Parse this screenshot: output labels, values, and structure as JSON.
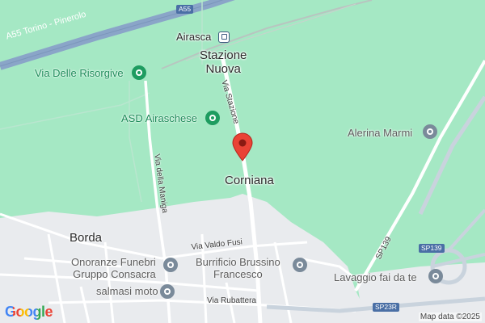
{
  "highways": [
    {
      "label": "A55",
      "kind": "shield"
    },
    {
      "label": "A55 Torino - Pinerolo",
      "kind": "highway-name"
    }
  ],
  "places": {
    "station": "Stazione Nuova",
    "station_line1": "Stazione",
    "station_line2": "Nuova",
    "airasca": "Airasca",
    "corniana": "Corniana",
    "borda": "Borda"
  },
  "pois": [
    {
      "name": "Via Delle Risorgive",
      "category": "green"
    },
    {
      "name": "ASD Airaschese",
      "category": "green"
    },
    {
      "name": "Alerina Marmi",
      "category": "grey"
    },
    {
      "name": "Onoranze Funebri Gruppo Consacra",
      "line1": "Onoranze Funebri",
      "line2": "Gruppo Consacra",
      "category": "grey"
    },
    {
      "name": "Burrificio Brussino Francesco",
      "line1": "Burrificio Brussino",
      "line2": "Francesco",
      "category": "grey"
    },
    {
      "name": "salmasi moto",
      "category": "grey"
    },
    {
      "name": "Lavaggio fai da te",
      "category": "grey"
    }
  ],
  "roads": {
    "via_stazione": "Via Stazione",
    "via_della_maniga": "Via della Maniga",
    "via_valdo_fusi": "Via Valdo Fusi",
    "via_rubattera": "Via Rubattera",
    "sp139": "SP139",
    "sp139_shield": "SP139",
    "sp23r_shield": "SP23R"
  },
  "branding": {
    "logo": "Google",
    "attribution": "Map data ©2025"
  },
  "colors": {
    "background": "#a5e8c4",
    "urban": "#e8eaed",
    "pin": "#ea4335"
  }
}
